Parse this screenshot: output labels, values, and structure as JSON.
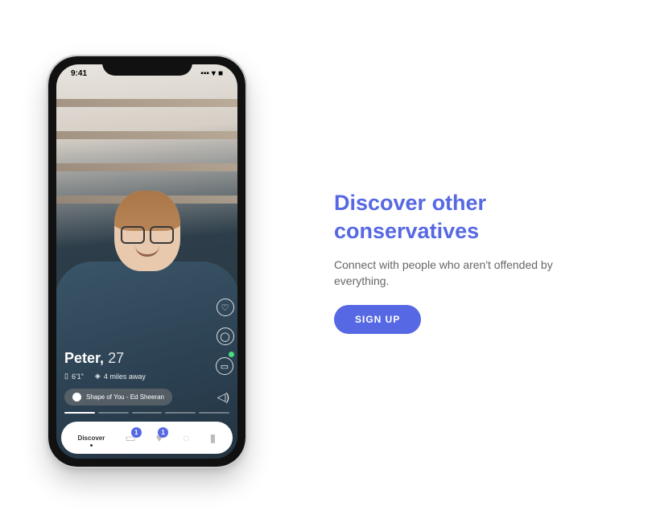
{
  "status": {
    "time": "9:41",
    "signal": "▪▪▪",
    "wifi": "▾",
    "battery": "■"
  },
  "profile": {
    "name": "Peter,",
    "age": "27",
    "height": "6'1\"",
    "distance": "4 miles away",
    "song": "Shape of You - Ed Sheeran"
  },
  "nav": {
    "discover": "Discover",
    "badge1": "1",
    "badge2": "1"
  },
  "content": {
    "headline": "Discover other conservatives",
    "subtitle": "Connect with people who aren't offended by everything.",
    "cta": "SIGN UP"
  },
  "icons": {
    "heart": "♡",
    "chat": "◯",
    "calendar": "▭",
    "height": "▯",
    "pin": "◈",
    "volume": "◁)",
    "card": "▭",
    "like": "♥",
    "msg": "◌",
    "user": "▮"
  }
}
